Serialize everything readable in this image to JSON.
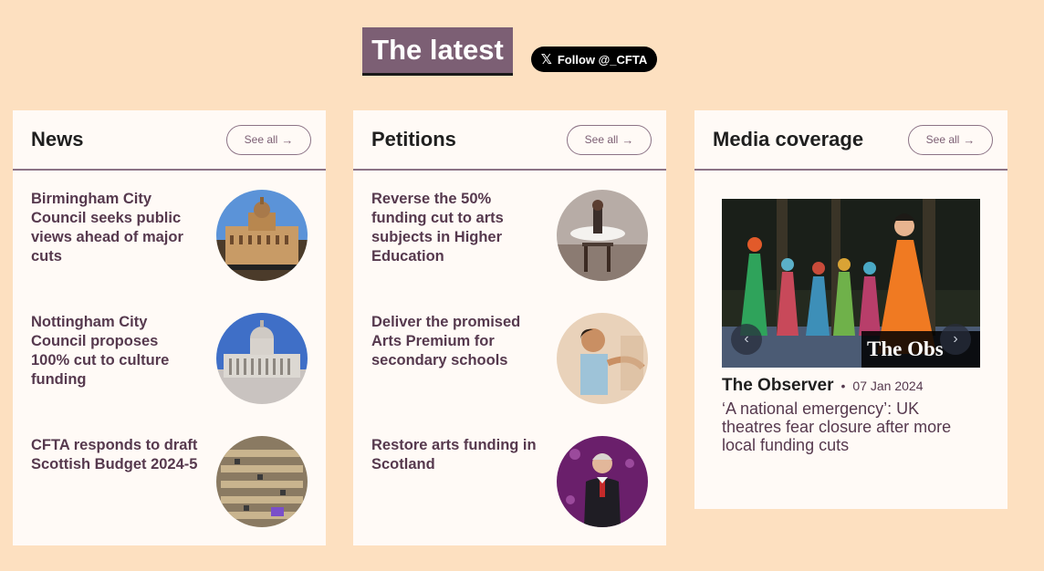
{
  "header": {
    "title": "The latest",
    "follow_label": "Follow @_CFTA",
    "follow_icon": "x-logo-icon"
  },
  "news": {
    "title": "News",
    "see_all": "See all",
    "items": [
      {
        "title": "Birmingham City Council seeks public views ahead of major cuts"
      },
      {
        "title": "Nottingham City Council proposes 100% cut to culture funding"
      },
      {
        "title": "CFTA responds to draft Scottish Budget 2024-5"
      }
    ]
  },
  "petitions": {
    "title": "Petitions",
    "see_all": "See all",
    "items": [
      {
        "title": "Reverse the 50% funding cut to arts subjects in Higher Education"
      },
      {
        "title": "Deliver the promised Arts Premium for secondary schools"
      },
      {
        "title": "Restore arts funding in Scotland"
      }
    ]
  },
  "media": {
    "title": "Media coverage",
    "see_all": "See all",
    "overlay_text": "The Obs",
    "source": "The Observer",
    "separator": "•",
    "date": "07 Jan 2024",
    "headline": "‘A national emergency’: UK theatres fear closure after more local funding cuts"
  },
  "colors": {
    "background": "#fde0c0",
    "accent": "#7c5f74",
    "card": "#fffaf6",
    "item_text": "#56394e"
  }
}
